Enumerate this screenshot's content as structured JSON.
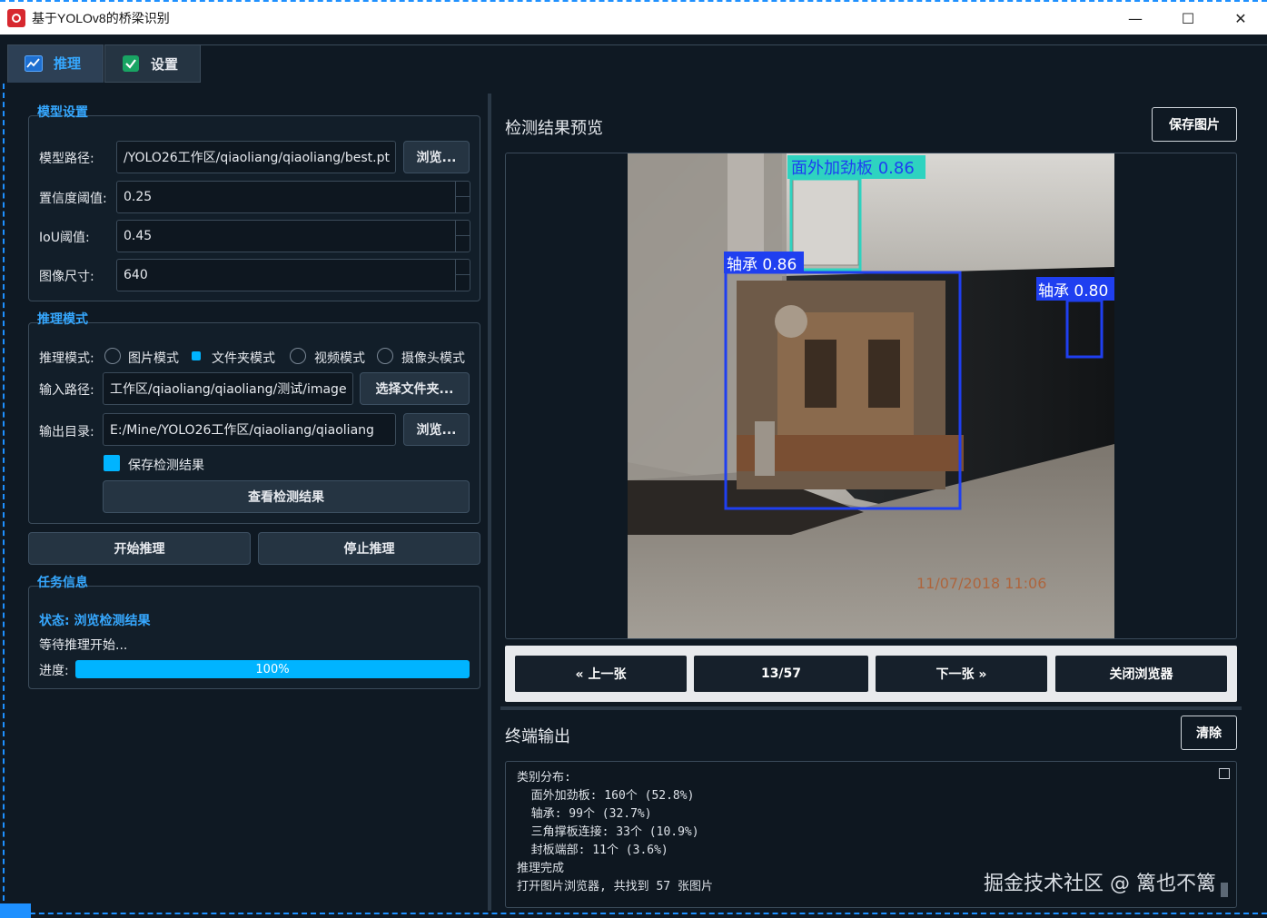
{
  "window": {
    "title": "基于YOLOv8的桥梁识别",
    "minimize": "—",
    "maximize": "☐",
    "close": "✕"
  },
  "tabs": [
    {
      "label": "推理",
      "icon": "chart-icon"
    },
    {
      "label": "设置",
      "icon": "checkbox-icon"
    }
  ],
  "model_settings": {
    "title": "模型设置",
    "model_path_label": "模型路径:",
    "model_path_value": "/YOLO26工作区/qiaoliang/qiaoliang/best.pt",
    "browse_label": "浏览...",
    "conf_label": "置信度阈值:",
    "conf_value": "0.25",
    "iou_label": "IoU阈值:",
    "iou_value": "0.45",
    "imgsz_label": "图像尺寸:",
    "imgsz_value": "640"
  },
  "infer_mode": {
    "title": "推理模式",
    "mode_label": "推理模式:",
    "modes": [
      "图片模式",
      "文件夹模式",
      "视频模式",
      "摄像头模式"
    ],
    "selected_mode": "文件夹模式",
    "input_label": "输入路径:",
    "input_value": "工作区/qiaoliang/qiaoliang/测试/image",
    "select_folder_label": "选择文件夹...",
    "output_label": "输出目录:",
    "output_value": "E:/Mine/YOLO26工作区/qiaoliang/qiaoliang",
    "browse_label": "浏览...",
    "save_results_label": "保存检测结果",
    "save_results_checked": true,
    "view_results_label": "查看检测结果"
  },
  "actions": {
    "start_label": "开始推理",
    "stop_label": "停止推理"
  },
  "task_info": {
    "title": "任务信息",
    "status_text": "状态: 浏览检测结果",
    "waiting_text": "等待推理开始...",
    "progress_label": "进度:",
    "progress_value": 100,
    "progress_text": "100%"
  },
  "preview": {
    "title": "检测结果预览",
    "save_image_label": "保存图片",
    "detections": [
      {
        "label": "面外加劲板 0.86",
        "color": "#2ed3c0"
      },
      {
        "label": "轴承 0.86",
        "color": "#1f3ff0"
      },
      {
        "label": "轴承 0.80",
        "color": "#1f3ff0"
      }
    ],
    "timestamp": "11/07/2018 11:06"
  },
  "navigation": {
    "prev_label": "« 上一张",
    "counter": "13/57",
    "next_label": "下一张 »",
    "close_label": "关闭浏览器"
  },
  "terminal": {
    "title": "终端输出",
    "clear_label": "清除",
    "lines": [
      "类别分布:",
      "  面外加劲板: 160个 (52.8%)",
      "  轴承: 99个 (32.7%)",
      "  三角撑板连接: 33个 (10.9%)",
      "  封板端部: 11个 (3.6%)",
      "推理完成",
      "打开图片浏览器, 共找到 57 张图片"
    ]
  },
  "watermark": "掘金技术社区 @ 篱也不篱",
  "colors": {
    "accent": "#36a8ff",
    "progress": "#00b4ff",
    "background": "#0f1923"
  }
}
